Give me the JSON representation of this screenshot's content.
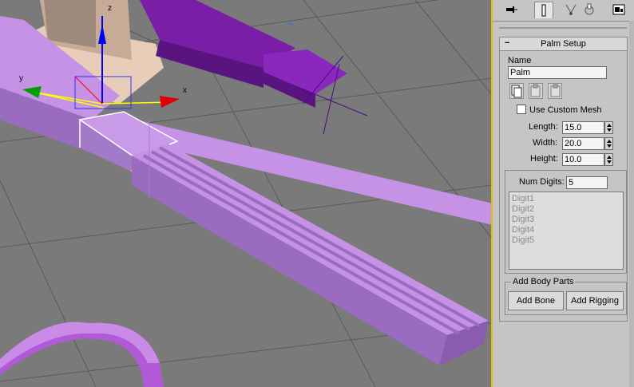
{
  "viewport": {
    "gizmo_axes": {
      "x": "x",
      "y": "y",
      "z": "z"
    }
  },
  "command_panel": {
    "tabs": [
      {
        "icon": "pin-icon"
      },
      {
        "icon": "modify-icon"
      },
      {
        "icon": "hierarchy-icon"
      },
      {
        "icon": "motion-icon"
      },
      {
        "icon": "utilities-icon"
      }
    ],
    "rollout": {
      "collapse_symbol": "−",
      "title": "Palm Setup",
      "name_label": "Name",
      "name_value": "Palm",
      "use_custom_mesh_label": "Use Custom Mesh",
      "use_custom_mesh_checked": false,
      "length_label": "Length:",
      "length_value": "15.0",
      "width_label": "Width:",
      "width_value": "20.0",
      "height_label": "Height:",
      "height_value": "10.0",
      "num_digits_label": "Num Digits:",
      "num_digits_value": "5",
      "digits": [
        "Digit1",
        "Digit2",
        "Digit3",
        "Digit4",
        "Digit5"
      ],
      "add_body_parts_label": "Add Body Parts",
      "add_bone_label": "Add Bone",
      "add_rigging_label": "Add Rigging"
    }
  },
  "colors": {
    "viewport_bg": "#7a7a7a",
    "panel_bg": "#c5c5c5",
    "selection": "#ffffff",
    "active_border": "#e0c000"
  }
}
